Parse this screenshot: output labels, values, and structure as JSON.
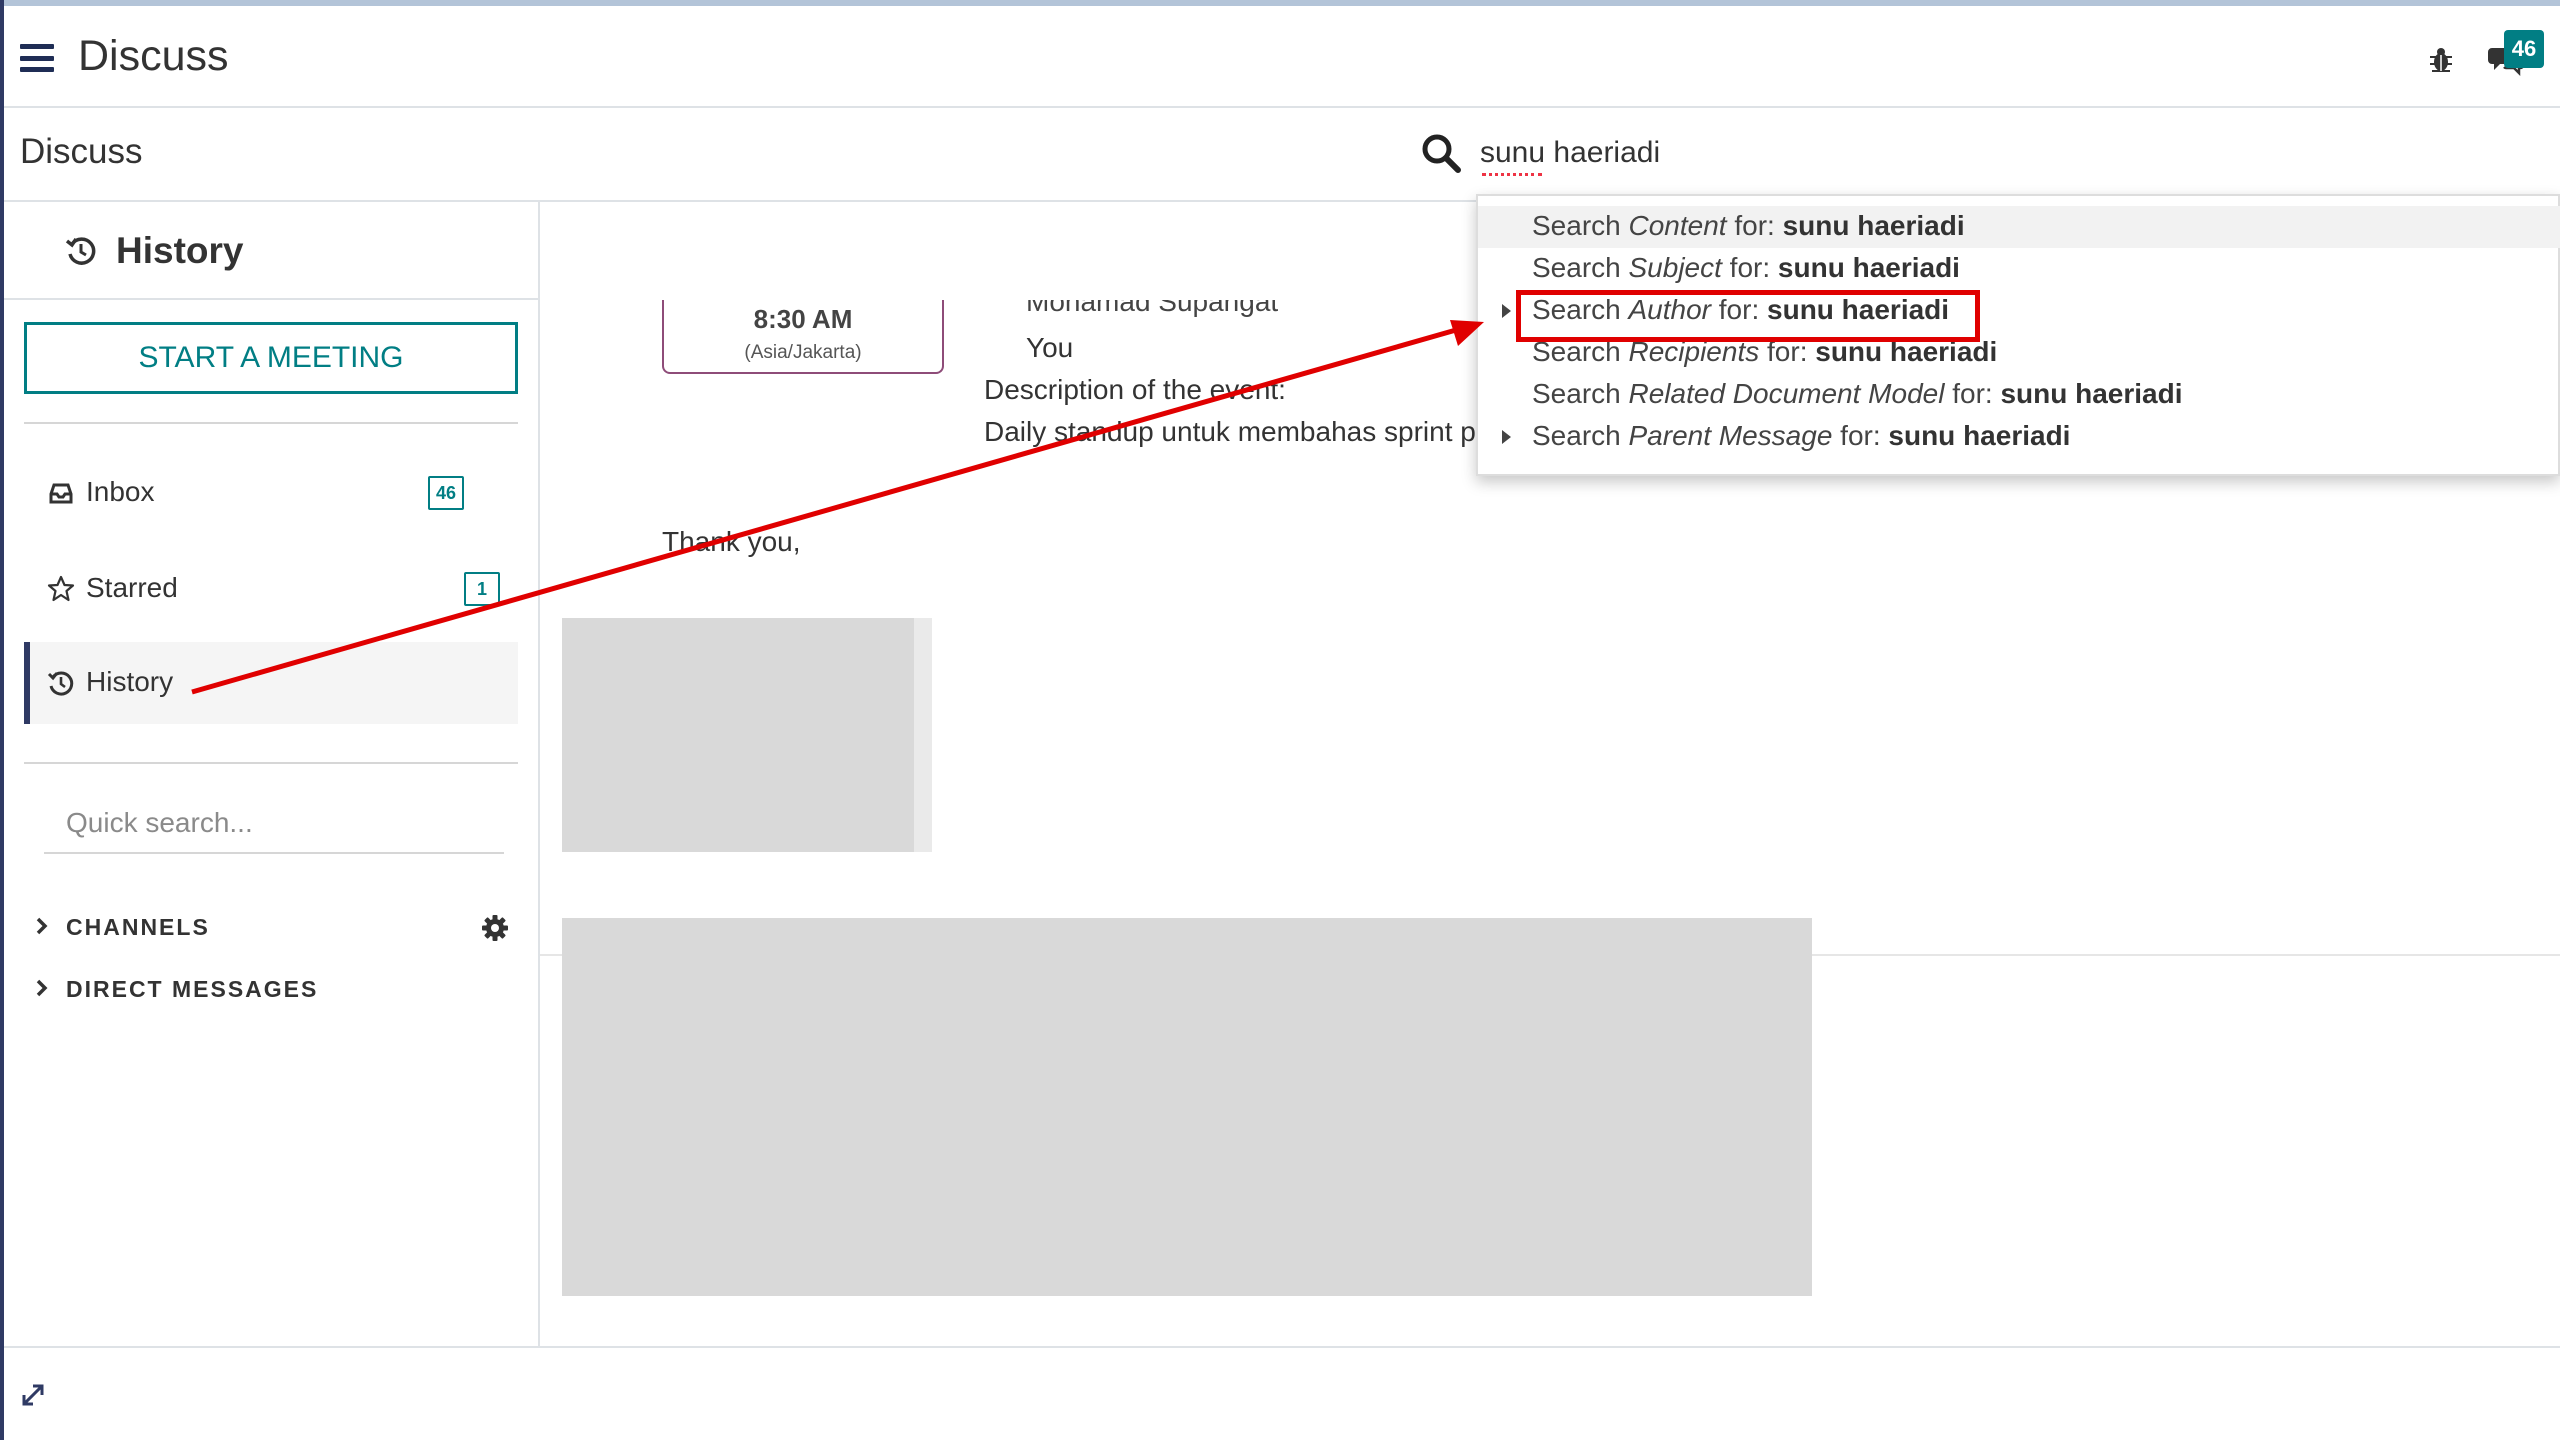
{
  "navbar": {
    "app_name": "Discuss",
    "notification_count": "46"
  },
  "control_panel": {
    "breadcrumb": "Discuss",
    "search_value": "sunu haeriadi"
  },
  "sidebar": {
    "header_title": "History",
    "start_meeting_label": "START A MEETING",
    "items": [
      {
        "label": "Inbox",
        "count": "46"
      },
      {
        "label": "Starred",
        "count": "1"
      },
      {
        "label": "History"
      }
    ],
    "quick_search_placeholder": "Quick search...",
    "categories": [
      {
        "label": "CHANNELS"
      },
      {
        "label": "DIRECT MESSAGES"
      }
    ]
  },
  "message": {
    "time": "8:30 AM",
    "timezone": "(Asia/Jakarta)",
    "attendees": [
      "Mohamad Supangat",
      "You"
    ],
    "description_label": "Description of the event:",
    "description_text": "Daily standup untuk membahas sprint p",
    "closing": "Thank you,"
  },
  "search_dropdown": {
    "items": [
      {
        "prefix": "Search ",
        "field": "Content",
        "mid": " for: ",
        "query": "sunu haeriadi",
        "expandable": false,
        "highlighted": true
      },
      {
        "prefix": "Search ",
        "field": "Subject",
        "mid": " for: ",
        "query": "sunu haeriadi",
        "expandable": false,
        "highlighted": false
      },
      {
        "prefix": "Search ",
        "field": "Author",
        "mid": " for: ",
        "query": "sunu haeriadi",
        "expandable": true,
        "highlighted": false
      },
      {
        "prefix": "Search ",
        "field": "Recipients",
        "mid": " for: ",
        "query": "sunu haeriadi",
        "expandable": false,
        "highlighted": false
      },
      {
        "prefix": "Search ",
        "field": "Related Document Model",
        "mid": " for: ",
        "query": "sunu haeriadi",
        "expandable": false,
        "highlighted": false
      },
      {
        "prefix": "Search ",
        "field": "Parent Message",
        "mid": " for: ",
        "query": "sunu haeriadi",
        "expandable": true,
        "highlighted": false
      }
    ]
  },
  "colors": {
    "accent": "#017e84",
    "annotation": "#e00000",
    "nav_dark": "#2f3a64"
  },
  "icons": [
    "menu-icon",
    "bug-icon",
    "chat-icon",
    "search-icon",
    "history-icon",
    "inbox-icon",
    "star-icon",
    "gear-icon",
    "chevron-right-icon",
    "expand-icon"
  ]
}
